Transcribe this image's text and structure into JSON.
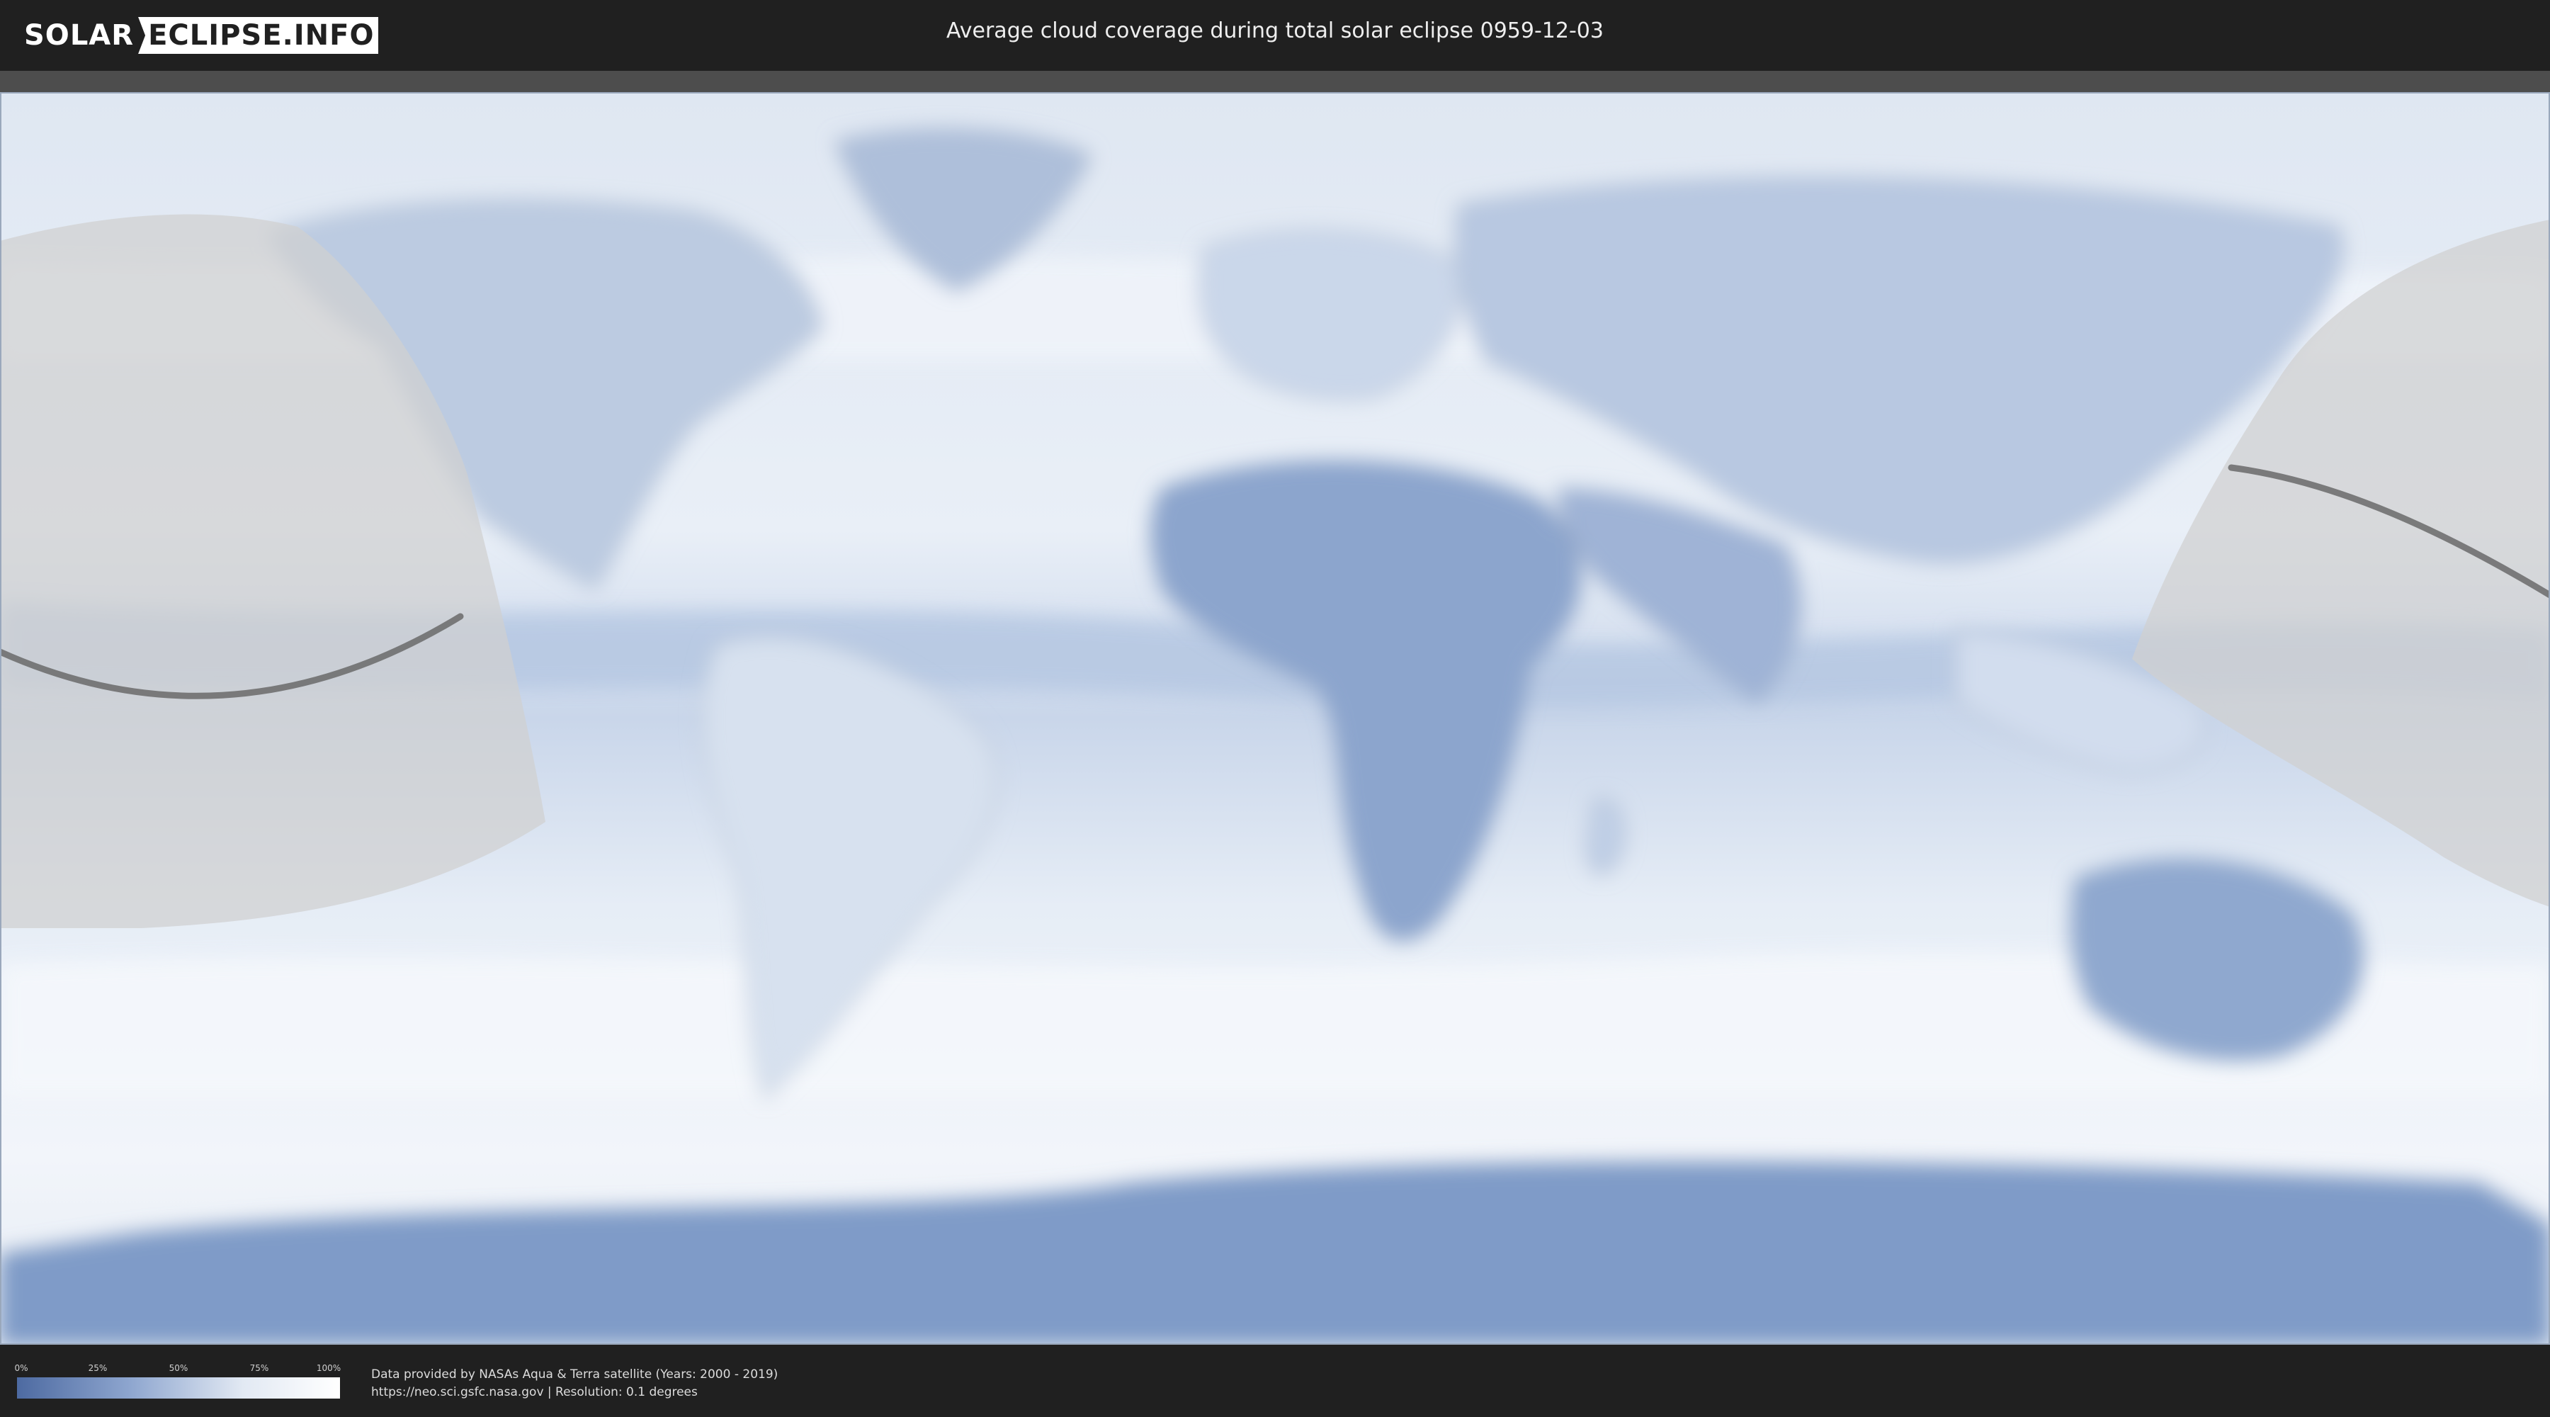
{
  "header": {
    "logo_part1": "SOLAR",
    "logo_part2": "ECLIPSE.INFO",
    "title": "Average cloud coverage during total solar eclipse 0959-12-03"
  },
  "legend": {
    "ticks": [
      "0%",
      "25%",
      "50%",
      "75%",
      "100%"
    ],
    "low_color": "#4d6aa1",
    "high_color": "#ffffff"
  },
  "credits": {
    "line1": "Data provided by NASAs Aqua & Terra satellite (Years: 2000 - 2019)",
    "line2": "https://neo.sci.gsfc.nasa.gov | Resolution: 0.1 degrees"
  },
  "map": {
    "projection": "equirectangular",
    "ocean_cloud_color": "#e4ecf5",
    "clear_sky_color": "#6f8dbf",
    "eclipse_region_color": "#c9c9c9",
    "eclipse_path_color": "#6a6a6a"
  }
}
